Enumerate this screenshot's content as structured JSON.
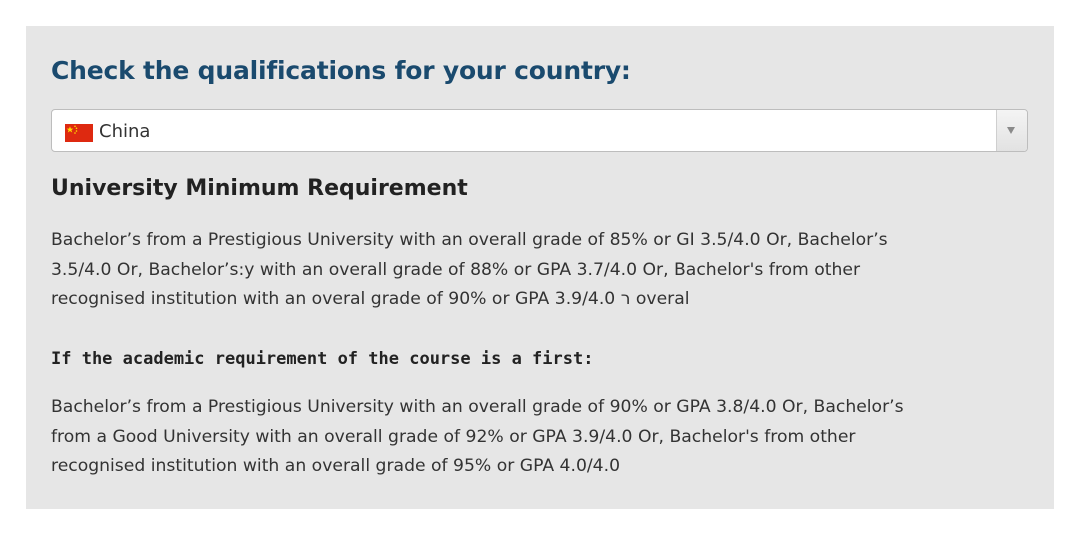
{
  "section": {
    "heading": "Check the qualifications for your country:"
  },
  "country_select": {
    "selected_value": "China",
    "flag_icon": "china-flag-icon",
    "arrow_icon": "chevron-down-icon"
  },
  "requirements": {
    "title": "University Minimum Requirement",
    "lines": [
      "Bachelor’s from a Prestigious University with an overall grade of 85% or GI    3.5/4.0 Or, Bachelor’s",
      "3.5/4.0 Or, Bachelor’s:y with an overall grade of 88% or GPA 3.7/4.0 Or, Bachelor's from other",
      "recognised institution with an overal  grade of 90% or GPA 3.9/4.0 ר overal"
    ]
  },
  "first_class": {
    "title": "If the academic requirement of the course is a first:",
    "lines": [
      "Bachelor’s from a Prestigious University with an overall grade of 90% or GPA 3.8/4.0 Or, Bachelor’s",
      "from a Good University with an overall grade of 92% or GPA 3.9/4.0 Or, Bachelor's from other",
      "recognised institution with an overall grade of 95% or GPA 4.0/4.0"
    ]
  },
  "colors": {
    "panel_background": "#e6e6e6",
    "heading_color": "#1a4a6e",
    "flag_red": "#de2910",
    "flag_star": "#ffde00"
  }
}
